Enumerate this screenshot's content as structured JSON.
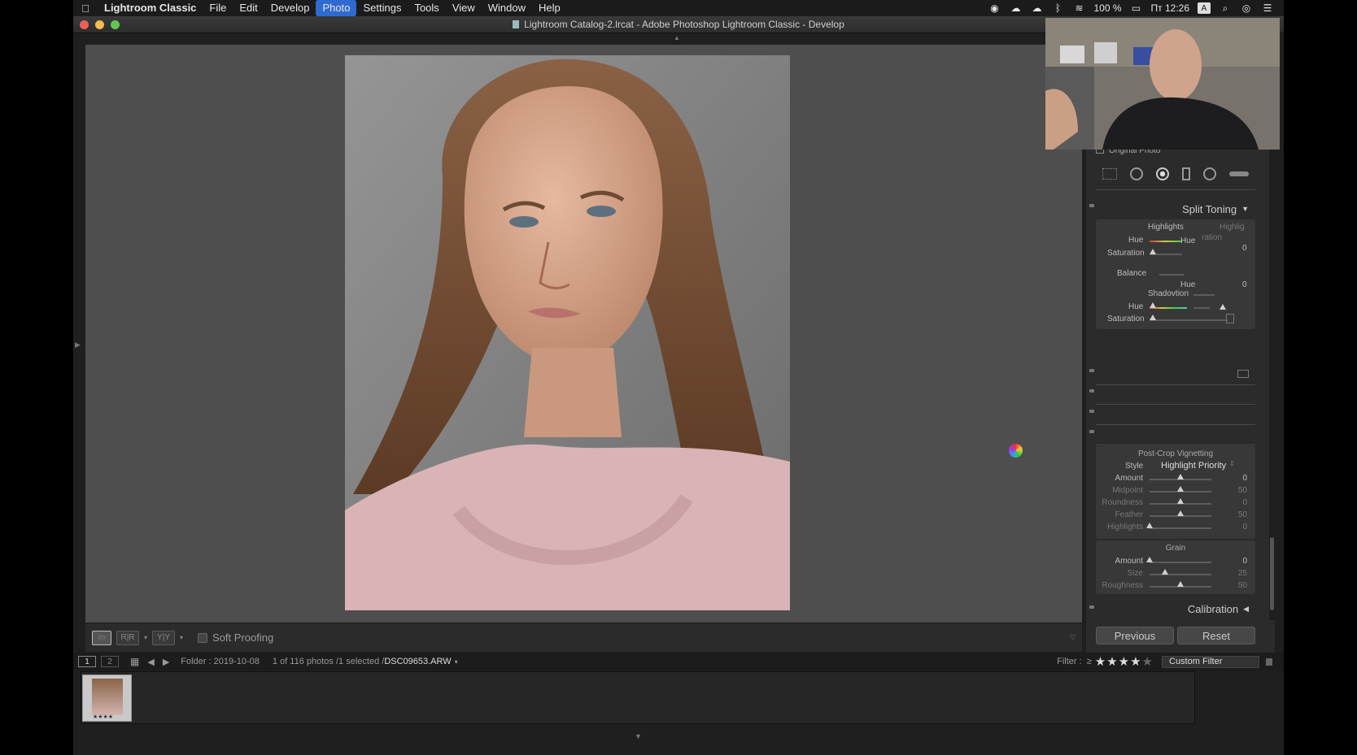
{
  "menubar": {
    "app": "Lightroom Classic",
    "items": [
      "File",
      "Edit",
      "Develop",
      "Photo",
      "Settings",
      "Tools",
      "View",
      "Window",
      "Help"
    ],
    "active": "Photo",
    "battery": "100 %",
    "clock": "Пт 12:26",
    "input_source": "A"
  },
  "window": {
    "title": "Lightroom Catalog-2.lrcat - Adobe Photoshop Lightroom Classic - Develop"
  },
  "right_panel": {
    "original_photo": "Original Photo",
    "split_toning": {
      "title": "Split Toning",
      "highlights": "Highlights",
      "highlights_cut": "Highlig",
      "hue_label": "Hue",
      "hue_tooltip": "Hue",
      "saturation_label": "Saturation",
      "saturation_fragment": "ration",
      "balance_label": "Balance",
      "balance_hue": "Hue",
      "balance_value": "0",
      "shadows_fragment": "Shadovtion",
      "shadow_hue_label": "Hue",
      "shadow_saturation_label": "Saturation",
      "highlight_hue_value": "0"
    },
    "vignetting": {
      "title": "Post-Crop Vignetting",
      "style_label": "Style",
      "style_value": "Highlight Priority",
      "rows": [
        {
          "label": "Amount",
          "value": "0",
          "pos": 0.5
        },
        {
          "label": "Midpoint",
          "value": "50",
          "pos": 0.5
        },
        {
          "label": "Roundness",
          "value": "0",
          "pos": 0.5
        },
        {
          "label": "Feather",
          "value": "50",
          "pos": 0.5
        },
        {
          "label": "Highlights",
          "value": "0",
          "pos": 0.0
        }
      ]
    },
    "grain": {
      "title": "Grain",
      "rows": [
        {
          "label": "Amount",
          "value": "0",
          "pos": 0.0
        },
        {
          "label": "Size",
          "value": "25",
          "pos": 0.25
        },
        {
          "label": "Roughness",
          "value": "50",
          "pos": 0.5
        }
      ]
    },
    "calibration": "Calibration",
    "previous": "Previous",
    "reset": "Reset"
  },
  "toolbar": {
    "soft_proofing": "Soft Proofing"
  },
  "filmstrip": {
    "page1": "1",
    "page2": "2",
    "folder": "Folder : 2019-10-08",
    "count": "1 of 116 photos /1 selected /",
    "filename": "DSC09653.ARW",
    "filter_label": "Filter :",
    "filter_op": "≥",
    "rating": 4,
    "custom_filter": "Custom Filter",
    "thumb_stars": "★★★★"
  },
  "colors": {
    "menu_highlight": "#2f6ad0",
    "close": "#ec5f56",
    "minimize": "#f5bd4f",
    "zoom": "#62c654"
  }
}
